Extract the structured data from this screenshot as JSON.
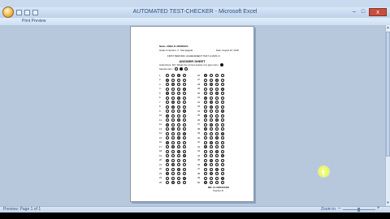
{
  "window": {
    "title": "AUTOMATED TEST-CHECKER  -  Microsoft Excel",
    "controls": [
      "–",
      "□",
      "x"
    ]
  },
  "ribbon": {
    "print_preview_label": "Print Preview"
  },
  "statusbar": {
    "page_info": "Preview: Page 1 of 1",
    "zoom_label": "Zoom in"
  },
  "answer_sheet": {
    "lines": [
      "Name: ANNA R. MENDOZA",
      "Grade & Section: 3 - Sampaguita",
      "Date: August 16, 2018",
      "FIRST PERIODIC ACHIEVEMENT TEST in MATH 3",
      "ANSWER SHEET",
      "Instructions: Fill / Shade the correct answer of a given item",
      "Sample Item:",
      "MR. AL ADRAVANO",
      "Teacher III"
    ]
  },
  "icons": {
    "office_button": "office-button-icon",
    "quick_access": [
      "save-icon",
      "undo-icon",
      "redo-icon"
    ],
    "cursor": "pointer-cursor-icon"
  }
}
